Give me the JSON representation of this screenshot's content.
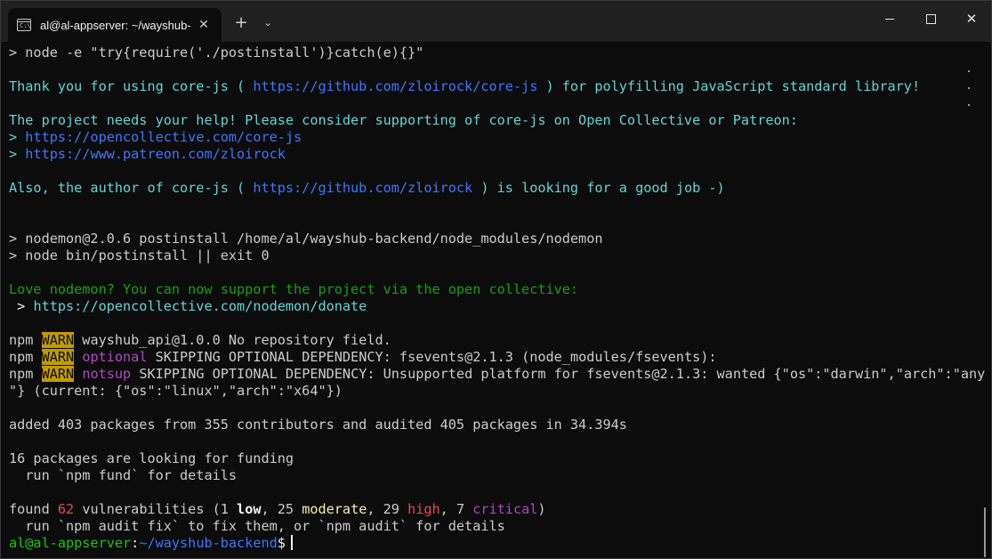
{
  "window": {
    "tab_title": "al@al-appserver: ~/wayshub-",
    "tab_icon_label": "C:\\",
    "tab_close": "✕",
    "new_tab": "+",
    "dropdown": "⌄",
    "close_glyph": "✕"
  },
  "terminal": {
    "lines": [
      [
        {
          "t": "> node -e \"try{require('./postinstall')}catch(e){}\""
        }
      ],
      [],
      [
        {
          "t": "Thank you for using core-js ( ",
          "c": "c-teal"
        },
        {
          "t": "https://github.com/zloirock/core-js",
          "c": "c-blue"
        },
        {
          "t": " ) for polyfilling JavaScript standard library!",
          "c": "c-teal"
        }
      ],
      [],
      [
        {
          "t": "The project needs your help! Please consider supporting of core-js on Open Collective or Patreon:",
          "c": "c-teal"
        }
      ],
      [
        {
          "t": "> ",
          "c": "c-teal"
        },
        {
          "t": "https://opencollective.com/core-js",
          "c": "c-blue"
        }
      ],
      [
        {
          "t": "> ",
          "c": "c-teal"
        },
        {
          "t": "https://www.patreon.com/zloirock",
          "c": "c-blue"
        }
      ],
      [],
      [
        {
          "t": "Also, the author of core-js ( ",
          "c": "c-teal"
        },
        {
          "t": "https://github.com/zloirock",
          "c": "c-blue"
        },
        {
          "t": " ) is looking for a good job -)",
          "c": "c-teal"
        }
      ],
      [],
      [],
      [
        {
          "t": "> nodemon@2.0.6 postinstall /home/al/wayshub-backend/node_modules/nodemon"
        }
      ],
      [
        {
          "t": "> node bin/postinstall || exit 0"
        }
      ],
      [],
      [
        {
          "t": "Love nodemon? You can now support the project via the open collective:",
          "c": "c-green2"
        }
      ],
      [
        {
          "t": " > ",
          "c": "c-white"
        },
        {
          "t": "https://opencollective.com/nodemon/donate",
          "c": "c-teal"
        }
      ],
      [],
      [
        {
          "t": "npm "
        },
        {
          "t": "WARN",
          "c": "warn-badge"
        },
        {
          "t": " wayshub_api@1.0.0 No repository field."
        }
      ],
      [
        {
          "t": "npm "
        },
        {
          "t": "WARN",
          "c": "warn-badge"
        },
        {
          "t": " "
        },
        {
          "t": "optional",
          "c": "c-magenta"
        },
        {
          "t": " SKIPPING OPTIONAL DEPENDENCY: fsevents@2.1.3 (node_modules/fsevents):"
        }
      ],
      [
        {
          "t": "npm "
        },
        {
          "t": "WARN",
          "c": "warn-badge"
        },
        {
          "t": " "
        },
        {
          "t": "notsup",
          "c": "c-magenta"
        },
        {
          "t": " SKIPPING OPTIONAL DEPENDENCY: Unsupported platform for fsevents@2.1.3: wanted {\"os\":\"darwin\",\"arch\":\"any"
        }
      ],
      [
        {
          "t": "\"} (current: {\"os\":\"linux\",\"arch\":\"x64\"})"
        }
      ],
      [],
      [
        {
          "t": "added 403 packages from 355 contributors and audited 405 packages in 34.394s"
        }
      ],
      [],
      [
        {
          "t": "16 packages are looking for funding"
        }
      ],
      [
        {
          "t": "  run `npm fund` for details"
        }
      ],
      [],
      [
        {
          "t": "found "
        },
        {
          "t": "62",
          "c": "c-red"
        },
        {
          "t": " vulnerabilities (1 "
        },
        {
          "t": "low",
          "c": "bold"
        },
        {
          "t": ", 25 "
        },
        {
          "t": "moderate",
          "c": "c-yellow"
        },
        {
          "t": ", 29 "
        },
        {
          "t": "high",
          "c": "c-red"
        },
        {
          "t": ", 7 "
        },
        {
          "t": "critical",
          "c": "c-magenta"
        },
        {
          "t": ")"
        }
      ],
      [
        {
          "t": "  run `npm audit fix` to fix them, or `npm audit` for details"
        }
      ]
    ],
    "prompt": {
      "user_host": "al@al-appserver",
      "separator": ":",
      "path": "~/wayshub-backend",
      "symbol": "$"
    }
  }
}
